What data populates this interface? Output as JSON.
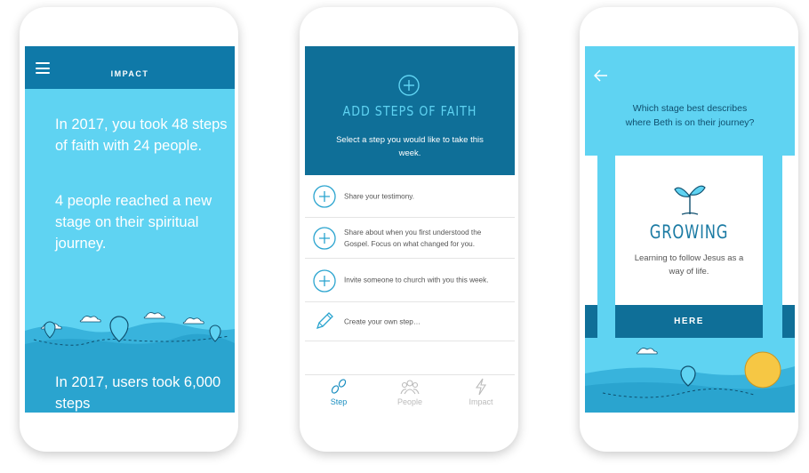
{
  "colors": {
    "light_blue": "#5fd3f2",
    "dark_blue": "#0f6f98",
    "header_blue": "#0f79a8"
  },
  "phone1": {
    "title": "IMPACT",
    "paragraph1": "In 2017, you took 48 steps of faith with 24 people.",
    "paragraph2": "4 people reached a new stage on their spiritual journey.",
    "paragraph3": "In 2017, users took 6,000 steps"
  },
  "phone2": {
    "hero_title": "ADD STEPS OF FAITH",
    "hero_subtitle": "Select a step you would like to take this week.",
    "steps": [
      {
        "label": "Share your testimony.",
        "icon": "plus-circle-icon"
      },
      {
        "label": "Share about when you first understood the Gospel. Focus on what changed for you.",
        "icon": "plus-circle-icon"
      },
      {
        "label": "Invite someone  to church with you this week.",
        "icon": "plus-circle-icon"
      },
      {
        "label": "Create your own step…",
        "icon": "pencil-icon"
      }
    ],
    "tabs": [
      {
        "label": "Step",
        "icon": "footsteps-icon",
        "active": true
      },
      {
        "label": "People",
        "icon": "people-icon",
        "active": false
      },
      {
        "label": "Impact",
        "icon": "lightning-icon",
        "active": false
      }
    ]
  },
  "phone3": {
    "question": "Which stage best describes where Beth is on their journey?",
    "stage_title": "GROWING",
    "stage_description": "Learning to follow Jesus as a way of life.",
    "button_label": "HERE"
  }
}
